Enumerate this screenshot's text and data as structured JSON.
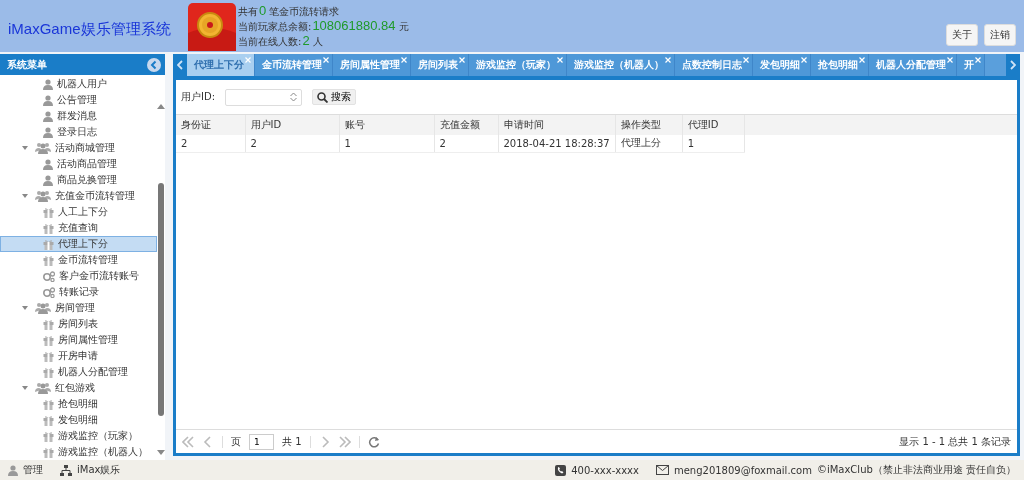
{
  "header": {
    "title": "iMaxGame娱乐管理系统",
    "stats": [
      {
        "label": "共有",
        "value": "0",
        "unit": "笔金币流转请求"
      },
      {
        "label": "当前玩家总余额:",
        "value": "108061880.84",
        "unit": "元"
      },
      {
        "label": "当前在线人数:",
        "value": "2",
        "unit": "人"
      }
    ],
    "buttons": [
      "关于",
      "注销"
    ]
  },
  "sidebar": {
    "title": "系统菜单",
    "items": [
      {
        "label": "机器人用户",
        "kind": "person",
        "selected": false
      },
      {
        "label": "公告管理",
        "kind": "person",
        "selected": false
      },
      {
        "label": "群发消息",
        "kind": "person",
        "selected": false
      },
      {
        "label": "登录日志",
        "kind": "person",
        "selected": false
      },
      {
        "label": "活动商城管理",
        "kind": "group",
        "expanded": true,
        "children": [
          {
            "label": "活动商品管理",
            "kind": "person",
            "selected": false
          },
          {
            "label": "商品兑换管理",
            "kind": "person",
            "selected": false
          }
        ]
      },
      {
        "label": "充值金币流转管理",
        "kind": "group",
        "expanded": true,
        "children": [
          {
            "label": "人工上下分",
            "kind": "box",
            "selected": false
          },
          {
            "label": "充值查询",
            "kind": "box",
            "selected": false
          },
          {
            "label": "代理上下分",
            "kind": "box",
            "selected": true
          },
          {
            "label": "金币流转管理",
            "kind": "box",
            "selected": false
          },
          {
            "label": "客户金币流转账号",
            "kind": "gears",
            "selected": false
          },
          {
            "label": "转账记录",
            "kind": "gears",
            "selected": false
          }
        ]
      },
      {
        "label": "房间管理",
        "kind": "group",
        "expanded": true,
        "children": [
          {
            "label": "房间列表",
            "kind": "box",
            "selected": false
          },
          {
            "label": "房间属性管理",
            "kind": "box",
            "selected": false
          },
          {
            "label": "开房申请",
            "kind": "box",
            "selected": false
          },
          {
            "label": "机器人分配管理",
            "kind": "box",
            "selected": false
          }
        ]
      },
      {
        "label": "红包游戏",
        "kind": "group",
        "expanded": true,
        "children": [
          {
            "label": "抢包明细",
            "kind": "box",
            "selected": false
          },
          {
            "label": "发包明细",
            "kind": "box",
            "selected": false
          },
          {
            "label": "游戏监控（玩家）",
            "kind": "box",
            "selected": false
          },
          {
            "label": "游戏监控（机器人）",
            "kind": "box",
            "selected": false
          }
        ]
      }
    ]
  },
  "tabs": [
    {
      "label": "代理上下分",
      "selected": true
    },
    {
      "label": "金币流转管理",
      "selected": false
    },
    {
      "label": "房间属性管理",
      "selected": false
    },
    {
      "label": "房间列表",
      "selected": false
    },
    {
      "label": "游戏监控（玩家）",
      "selected": false
    },
    {
      "label": "游戏监控（机器人）",
      "selected": false
    },
    {
      "label": "点数控制日志",
      "selected": false
    },
    {
      "label": "发包明细",
      "selected": false
    },
    {
      "label": "抢包明细",
      "selected": false
    },
    {
      "label": "机器人分配管理",
      "selected": false
    },
    {
      "label": "开",
      "selected": false
    }
  ],
  "search": {
    "label": "用户ID:",
    "button": "搜索"
  },
  "table": {
    "columns": [
      "身份证",
      "用户ID",
      "账号",
      "充值金额",
      "申请时间",
      "操作类型",
      "代理ID"
    ],
    "rows": [
      [
        "2",
        "2",
        "1",
        "2",
        "2018-04-21 18:28:37",
        "代理上分",
        "1"
      ]
    ]
  },
  "pager": {
    "page_label": "页",
    "page": "1",
    "total": "共 1",
    "summary": "显示 1 - 1 总共 1 条记录"
  },
  "footer": {
    "left": [
      {
        "kind": "person",
        "text": "管理"
      },
      {
        "kind": "org",
        "text": "iMax娱乐"
      }
    ],
    "right": [
      {
        "kind": "phone",
        "text": "400-xxx-xxxx"
      },
      {
        "kind": "mail",
        "text": "meng201809@foxmail.com"
      },
      {
        "kind": "plain",
        "text": "©iMaxClub（禁止非法商业用途 责任自负）"
      }
    ]
  }
}
